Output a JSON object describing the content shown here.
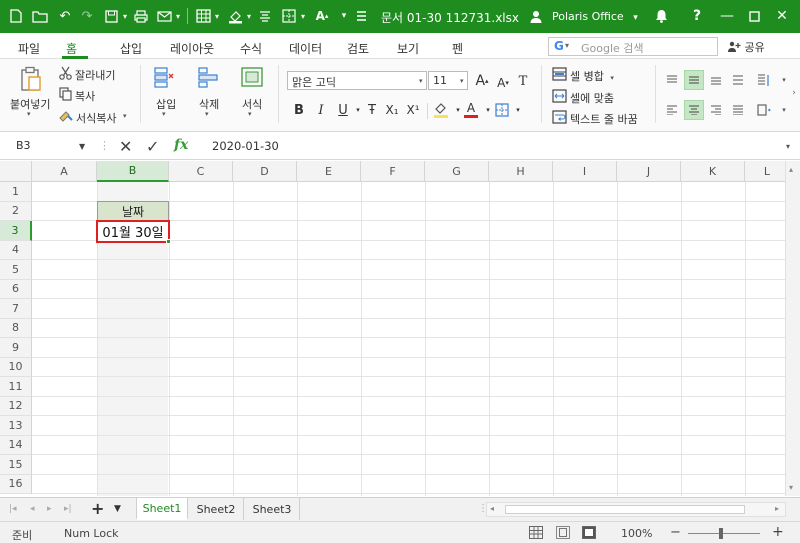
{
  "titlebar": {
    "title": "문서 01-30 112731.xlsx",
    "user": "Polaris Office",
    "user_arrow": "▾",
    "colors": {
      "bar": "#1f8c20"
    }
  },
  "menu": {
    "tabs": [
      "파일",
      "홈",
      "삽입",
      "레이아웃",
      "수식",
      "데이터",
      "검토",
      "보기",
      "펜"
    ],
    "active": "홈",
    "search_placeholder": "Google 검색",
    "search_logo": "G",
    "share_label": "공유"
  },
  "ribbon": {
    "paste_label": "붙여넣기",
    "cut_label": "잘라내기",
    "copy_label": "복사",
    "format_copy_label": "서식복사",
    "insert_label": "삽입",
    "delete_label": "삭제",
    "format_label": "서식",
    "font_name": "맑은 고딕",
    "font_size": "11",
    "bold": "B",
    "italic": "I",
    "underline": "U",
    "strike": "Ŧ",
    "subscript": "X₁",
    "superscript": "X¹",
    "grow_font": "A",
    "shrink_font": "A",
    "clear_format": "T",
    "font_color_letter": "A",
    "merge_cells_label": "셀 병합",
    "fit_cell_label": "셀에 맞춤",
    "wrap_text_label": "텍스트 줄 바꿈"
  },
  "formula_bar": {
    "cell_ref": "B3",
    "formula": "2020-01-30",
    "fx": "fx"
  },
  "grid": {
    "columns": [
      "A",
      "B",
      "C",
      "D",
      "E",
      "F",
      "G",
      "H",
      "I",
      "J",
      "K",
      "L"
    ],
    "rows": [
      "1",
      "2",
      "3",
      "4",
      "5",
      "6",
      "7",
      "8",
      "9",
      "10",
      "11",
      "12",
      "13",
      "14",
      "15",
      "16"
    ],
    "selected_column": "B",
    "selected_row": "3",
    "header_cell_text": "날짜",
    "selected_cell_text": "01월 30일"
  },
  "sheets": {
    "tabs": [
      "Sheet1",
      "Sheet2",
      "Sheet3"
    ],
    "active": "Sheet1",
    "add_symbol": "+",
    "menu_symbol": "▼"
  },
  "status": {
    "ready": "준비",
    "numlock": "Num Lock",
    "zoom": "100%",
    "zoom_minus": "−",
    "zoom_plus": "+"
  }
}
